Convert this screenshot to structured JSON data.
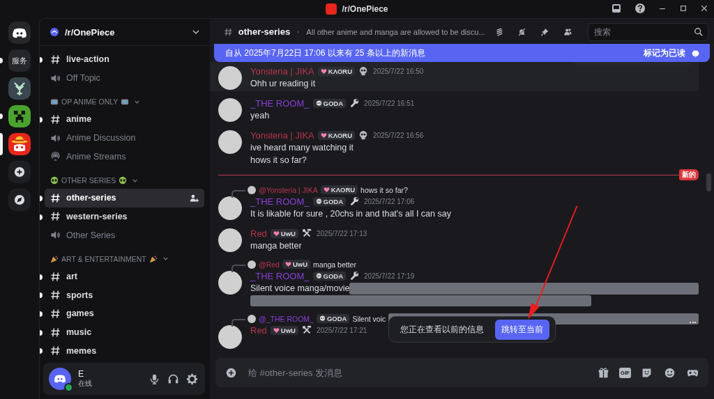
{
  "titlebar": {
    "title": "/r/OnePiece"
  },
  "servers": [
    {
      "kind": "home",
      "selected": false,
      "unread": false
    },
    {
      "kind": "text",
      "label": "服务",
      "selected": false,
      "unread": true
    },
    {
      "kind": "emblem",
      "selected": false,
      "unread": false
    },
    {
      "kind": "creeper",
      "selected": false,
      "unread": true
    },
    {
      "kind": "strawhat",
      "selected": true
    },
    {
      "kind": "add",
      "selected": false,
      "unread": false
    },
    {
      "kind": "discover",
      "selected": false,
      "unread": false
    }
  ],
  "guild": {
    "name": "/r/OnePiece"
  },
  "channels": [
    {
      "kind": "text",
      "name": "live-action",
      "unread": true,
      "selected": false
    },
    {
      "kind": "voice",
      "name": "Off Topic",
      "unread": false,
      "selected": false
    },
    {
      "kind": "category",
      "name": "OP ANIME ONLY"
    },
    {
      "kind": "text",
      "name": "anime",
      "unread": true,
      "selected": false
    },
    {
      "kind": "voice",
      "name": "Anime Discussion",
      "unread": false,
      "selected": false
    },
    {
      "kind": "stage",
      "name": "Anime Streams",
      "unread": false,
      "selected": false
    },
    {
      "kind": "category",
      "name": "OTHER SERIES"
    },
    {
      "kind": "text",
      "name": "other-series",
      "unread": true,
      "selected": true
    },
    {
      "kind": "text",
      "name": "western-series",
      "unread": true,
      "selected": false
    },
    {
      "kind": "voice",
      "name": "Other Series",
      "unread": false,
      "selected": false
    },
    {
      "kind": "category",
      "name": "ART & ENTERTAINMENT"
    },
    {
      "kind": "text",
      "name": "art",
      "unread": true,
      "selected": false
    },
    {
      "kind": "text",
      "name": "sports",
      "unread": true,
      "selected": false
    },
    {
      "kind": "text",
      "name": "games",
      "unread": true,
      "selected": false
    },
    {
      "kind": "text",
      "name": "music",
      "unread": true,
      "selected": false
    },
    {
      "kind": "text",
      "name": "memes",
      "unread": true,
      "selected": false
    }
  ],
  "user": {
    "name": "E",
    "status": "在线"
  },
  "header": {
    "channel": "other-series",
    "topic": "All other anime and manga are allowed to be discu...",
    "search_placeholder": "搜索"
  },
  "banner": {
    "text": "自从 2025年7月22日 17:06 以来有 25 条以上的新消息",
    "button": "标记为已读"
  },
  "messages": [
    {
      "kind": "message",
      "hovered": true,
      "author": "Yonsteria | JIKA",
      "color": "#b8364a",
      "tag": {
        "text": "KΛORU",
        "kind": "heart"
      },
      "time": "2025/7/22 16:50",
      "lines": [
        "Ohh ur reading it"
      ]
    },
    {
      "kind": "message",
      "author": "_THE ROOM_",
      "color": "#8a3fd6",
      "tag": {
        "text": "GODA",
        "kind": "skull"
      },
      "time": "2025/7/22 16:51",
      "lines": [
        "yeah"
      ]
    },
    {
      "kind": "message",
      "author": "Yonsteria | JIKA",
      "color": "#b8364a",
      "tag": {
        "text": "KΛORU",
        "kind": "heart"
      },
      "time": "2025/7/22 16:56",
      "lines": [
        "ive heard many watching it",
        "hows it so far?"
      ]
    },
    {
      "kind": "divider",
      "label": "新的"
    },
    {
      "kind": "message",
      "reply": {
        "author": "@Yonsteria | JIKA",
        "color": "#b8364a",
        "tag": {
          "text": "KΛORU",
          "kind": "heart"
        },
        "text": "hows it so far?"
      },
      "author": "_THE ROOM_",
      "color": "#8a3fd6",
      "tag": {
        "text": "GODA",
        "kind": "skull"
      },
      "time": "2025/7/22 17:06",
      "lines": [
        "It is likable for sure , 20chs in and that's all I can say"
      ]
    },
    {
      "kind": "message",
      "author": "Red",
      "color": "#b8364a",
      "tag": {
        "text": "UwU",
        "kind": "heart"
      },
      "time": "2025/7/22 17:13",
      "lines": [
        "manga better"
      ]
    },
    {
      "kind": "message",
      "reply": {
        "author": "@Red",
        "color": "#b8364a",
        "tag": {
          "text": "UwU",
          "kind": "heart"
        },
        "text": "manga better"
      },
      "author": "_THE ROOM_",
      "color": "#8a3fd6",
      "tag": {
        "text": "GODA",
        "kind": "skull"
      },
      "time": "2025/7/22 17:19",
      "lines": [
        "Silent voice manga/movie"
      ],
      "spoiler": true
    },
    {
      "kind": "message",
      "reply": {
        "author": "@_THE ROOM_",
        "color": "#8a3fd6",
        "tag": {
          "text": "GODA",
          "kind": "skull"
        },
        "text": "Silent voic",
        "spoiler": true
      },
      "author": "Red",
      "color": "#b8364a",
      "tag": {
        "text": "UwU",
        "kind": "heart"
      },
      "time": "2025/7/22 17:21"
    }
  ],
  "toast": {
    "text": "您正在查看以前的信息",
    "button": "跳转至当前"
  },
  "composer": {
    "placeholder": "给 #other-series 发消息",
    "gif_label": "GIF"
  }
}
